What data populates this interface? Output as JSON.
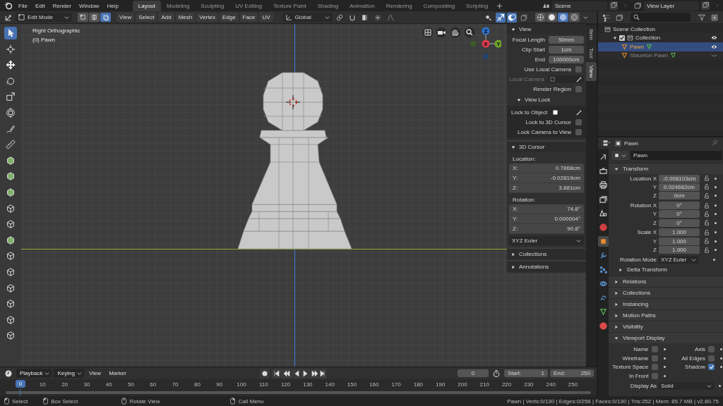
{
  "top_bar": {
    "menus": [
      "File",
      "Edit",
      "Render",
      "Window",
      "Help"
    ],
    "workspaces": [
      {
        "label": "Layout",
        "selected": true
      },
      {
        "label": "Modeling",
        "selected": false
      },
      {
        "label": "Sculpting",
        "selected": false
      },
      {
        "label": "UV Editing",
        "selected": false
      },
      {
        "label": "Texture Paint",
        "selected": false
      },
      {
        "label": "Shading",
        "selected": false
      },
      {
        "label": "Animation",
        "selected": false
      },
      {
        "label": "Rendering",
        "selected": false
      },
      {
        "label": "Compositing",
        "selected": false
      },
      {
        "label": "Scripting",
        "selected": false
      }
    ],
    "scene": "Scene",
    "view_layer": "View Layer"
  },
  "viewport_header": {
    "mode": "Edit Mode",
    "select_modes": [
      {
        "kind": "vertex",
        "selected": false
      },
      {
        "kind": "edge",
        "selected": false
      },
      {
        "kind": "face",
        "selected": true
      }
    ],
    "menus": [
      "View",
      "Select",
      "Add",
      "Mesh",
      "Vertex",
      "Edge",
      "Face",
      "UV"
    ],
    "orientation": "Global",
    "shading": [
      {
        "kind": "wireframe",
        "selected": false
      },
      {
        "kind": "solid",
        "selected": false
      },
      {
        "kind": "material",
        "selected": true
      },
      {
        "kind": "rendered",
        "selected": false
      }
    ]
  },
  "tools": [
    {
      "kind": "select",
      "selected": true
    },
    {
      "kind": "cursor",
      "selected": false
    },
    {
      "kind": "move",
      "selected": false
    },
    {
      "kind": "rotate",
      "selected": false
    },
    {
      "kind": "scale",
      "selected": false
    },
    {
      "kind": "transform",
      "selected": false
    },
    {
      "kind": "annotate",
      "selected": false
    },
    {
      "kind": "measure",
      "selected": false
    },
    {
      "kind": "extrude",
      "selected": false
    },
    {
      "kind": "inset",
      "selected": false
    },
    {
      "kind": "bevel",
      "selected": false
    },
    {
      "kind": "loopcut",
      "selected": false
    },
    {
      "kind": "knife",
      "selected": false
    },
    {
      "kind": "polybuild",
      "selected": false
    },
    {
      "kind": "spin",
      "selected": false
    },
    {
      "kind": "smooth",
      "selected": false
    },
    {
      "kind": "slide",
      "selected": false
    },
    {
      "kind": "shrink",
      "selected": false
    },
    {
      "kind": "shear",
      "selected": false
    },
    {
      "kind": "rip",
      "selected": false
    }
  ],
  "viewport": {
    "view_name": "Right Orthographic",
    "object_label": "(0) Pawn",
    "gizmo": [
      {
        "label": "Z",
        "color": "#2e73d2"
      },
      {
        "label": "Y",
        "color": "#70a52b"
      },
      {
        "label": "X",
        "color": "#e2394c"
      }
    ]
  },
  "sidebar": {
    "tabs": [
      {
        "label": "Item",
        "selected": false
      },
      {
        "label": "Tool",
        "selected": false
      },
      {
        "label": "View",
        "selected": true
      }
    ],
    "view": {
      "title": "View",
      "expanded": true,
      "fields": [
        {
          "label": "Focal Length",
          "value": "50mm"
        },
        {
          "label": "Clip Start",
          "value": "1cm"
        },
        {
          "label": "End",
          "value": "100000cm"
        }
      ],
      "checks": [
        {
          "label": "Use Local Camera",
          "checked": false
        }
      ],
      "local_camera": {
        "label": "Local Camera",
        "disabled": true
      },
      "render_region": {
        "label": "Render Region",
        "checked": false
      }
    },
    "view_lock": {
      "title": "View Lock",
      "expanded": true,
      "lock_to_object": "Lock to Object",
      "checks": [
        {
          "label": "Lock to 3D Cursor",
          "checked": false
        },
        {
          "label": "Lock Camera to View",
          "checked": false
        }
      ]
    },
    "cursor": {
      "title": "3D Cursor",
      "expanded": true,
      "location_label": "Location:",
      "location": [
        {
          "axis": "X:",
          "value": "0.7868cm"
        },
        {
          "axis": "Y:",
          "value": "-0.02819cm"
        },
        {
          "axis": "Z:",
          "value": "3.881cm"
        }
      ],
      "rotation_label": "Rotation:",
      "rotation": [
        {
          "axis": "X:",
          "value": "74.8°"
        },
        {
          "axis": "Y:",
          "value": "0.000004°"
        },
        {
          "axis": "Z:",
          "value": "90.8°"
        }
      ],
      "rotation_mode": "XYZ Euler"
    },
    "sections": [
      {
        "title": "Collections",
        "expanded": false
      },
      {
        "title": "Annotations",
        "expanded": false
      }
    ]
  },
  "outliner": {
    "tree": [
      {
        "label": "Scene Collection",
        "kind": "scene",
        "children": [
          {
            "label": "Collection",
            "kind": "collection",
            "expanded": true,
            "included": true,
            "visible": true,
            "selected": false,
            "children": [
              {
                "label": "Pawn",
                "kind": "object",
                "selected": true,
                "visible": true
              },
              {
                "label": "Staunton Pawn",
                "kind": "object",
                "selected": false,
                "visible": false
              }
            ]
          }
        ]
      }
    ]
  },
  "properties": {
    "object_name": "Pawn",
    "tabs": [
      {
        "kind": "tool",
        "selected": false
      },
      {
        "kind": "render",
        "selected": false
      },
      {
        "kind": "output",
        "selected": false
      },
      {
        "kind": "viewlayer",
        "selected": false
      },
      {
        "kind": "scene",
        "selected": false
      },
      {
        "kind": "world",
        "selected": false
      },
      {
        "kind": "object",
        "selected": true
      },
      {
        "kind": "modifier",
        "selected": false
      },
      {
        "kind": "particles",
        "selected": false
      },
      {
        "kind": "physics",
        "selected": false
      },
      {
        "kind": "constraints",
        "selected": false
      },
      {
        "kind": "data",
        "selected": false
      },
      {
        "kind": "material",
        "selected": false
      }
    ],
    "name_field": "Pawn",
    "transform": {
      "title": "Transform",
      "expanded": true,
      "rows": [
        {
          "label": "Location X",
          "value": "-0.006103cm"
        },
        {
          "label": "Y",
          "value": "0.024682cm"
        },
        {
          "label": "Z",
          "value": "0cm"
        },
        {
          "label": "Rotation X",
          "value": "0°"
        },
        {
          "label": "Y",
          "value": "0°"
        },
        {
          "label": "Z",
          "value": "0°"
        },
        {
          "label": "Scale X",
          "value": "1.000"
        },
        {
          "label": "Y",
          "value": "1.000"
        },
        {
          "label": "Z",
          "value": "1.000"
        }
      ],
      "rotation_mode_label": "Rotation Mode",
      "rotation_mode": "XYZ Euler",
      "delta": {
        "title": "Delta Transform",
        "expanded": false
      }
    },
    "sections": [
      {
        "title": "Relations",
        "expanded": false
      },
      {
        "title": "Collections",
        "expanded": false
      },
      {
        "title": "Instancing",
        "expanded": false
      },
      {
        "title": "Motion Paths",
        "expanded": false
      },
      {
        "title": "Visibility",
        "expanded": false
      },
      {
        "title": "Viewport Display",
        "expanded": true
      }
    ],
    "viewport_display": {
      "checks": [
        {
          "label": "Name",
          "checked": false
        },
        {
          "label": "Axis",
          "checked": false
        },
        {
          "label": "Wireframe",
          "checked": false
        },
        {
          "label": "All Edges",
          "checked": false
        },
        {
          "label": "Texture Space",
          "checked": false
        },
        {
          "label": "Shadow",
          "checked": true
        },
        {
          "label": "In Front",
          "checked": false
        }
      ],
      "display_as_label": "Display As",
      "display_as": "Solid"
    }
  },
  "timeline": {
    "menus": [
      "Playback",
      "Keying",
      "View",
      "Marker"
    ],
    "frame": "0",
    "start_label": "Start:",
    "start": "1",
    "end_label": "End:",
    "end": "250",
    "ruler": [
      {
        "label": "0",
        "selected": true
      },
      {
        "label": "10",
        "selected": false
      },
      {
        "label": "20",
        "selected": false
      },
      {
        "label": "30",
        "selected": false
      },
      {
        "label": "40",
        "selected": false
      },
      {
        "label": "50",
        "selected": false
      },
      {
        "label": "60",
        "selected": false
      },
      {
        "label": "70",
        "selected": false
      },
      {
        "label": "80",
        "selected": false
      },
      {
        "label": "90",
        "selected": false
      },
      {
        "label": "100",
        "selected": false
      },
      {
        "label": "110",
        "selected": false
      },
      {
        "label": "120",
        "selected": false
      },
      {
        "label": "130",
        "selected": false
      },
      {
        "label": "140",
        "selected": false
      },
      {
        "label": "150",
        "selected": false
      },
      {
        "label": "160",
        "selected": false
      },
      {
        "label": "170",
        "selected": false
      },
      {
        "label": "180",
        "selected": false
      },
      {
        "label": "190",
        "selected": false
      },
      {
        "label": "200",
        "selected": false
      },
      {
        "label": "210",
        "selected": false
      },
      {
        "label": "220",
        "selected": false
      },
      {
        "label": "230",
        "selected": false
      },
      {
        "label": "240",
        "selected": false
      },
      {
        "label": "250",
        "selected": false
      }
    ]
  },
  "status_bar": {
    "hints": [
      {
        "kind": "left",
        "label": "Select"
      },
      {
        "kind": "drag",
        "label": "Box Select"
      },
      {
        "kind": "middle",
        "label": "Rotate View"
      },
      {
        "kind": "right",
        "label": "Call Menu"
      }
    ],
    "stats": "Pawn | Verts:0/130 | Edges:0/256 | Faces:0/130 | Tris:252 | Mem: 85.7 MB | v2.80.75"
  }
}
